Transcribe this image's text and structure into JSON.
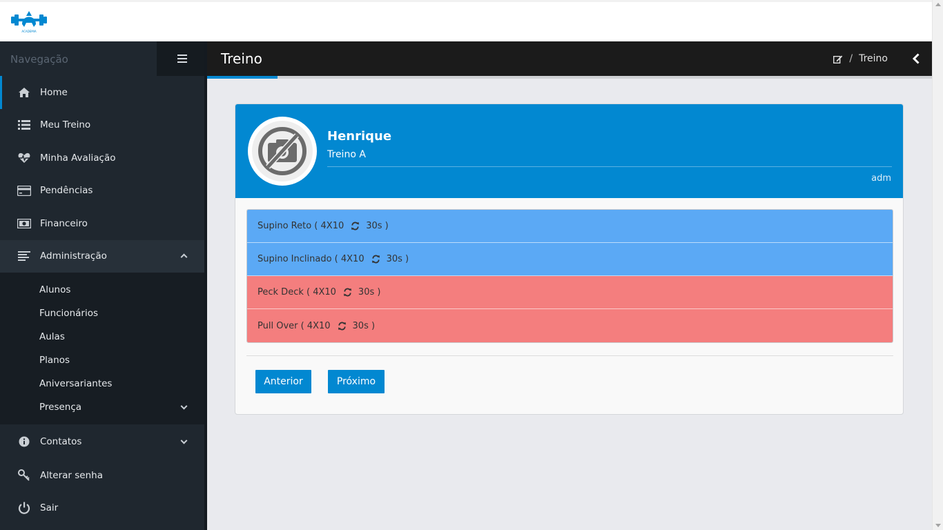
{
  "brand": {
    "logo_icon": "gym-spartan-logo",
    "logo_text": "ACADEMIA",
    "color": "#0288d1"
  },
  "sidebar": {
    "title": "Navegação",
    "items": [
      {
        "label": "Home",
        "icon": "home-icon",
        "active": true
      },
      {
        "label": "Meu Treino",
        "icon": "list-icon"
      },
      {
        "label": "Minha Avaliação",
        "icon": "heartbeat-icon"
      },
      {
        "label": "Pendências",
        "icon": "credit-card-icon"
      },
      {
        "label": "Financeiro",
        "icon": "money-icon"
      },
      {
        "label": "Administração",
        "icon": "align-left-icon",
        "expanded": true,
        "children": [
          "Alunos",
          "Funcionários",
          "Aulas",
          "Planos",
          "Aniversariantes",
          "Presença"
        ]
      },
      {
        "label": "Contatos",
        "icon": "info-icon"
      },
      {
        "label": "Alterar senha",
        "icon": "key-icon"
      },
      {
        "label": "Sair",
        "icon": "power-icon"
      }
    ]
  },
  "header": {
    "title": "Treino",
    "breadcrumb": {
      "sep": "/",
      "current": "Treino"
    }
  },
  "card": {
    "name": "Henrique",
    "subtitle": "Treino A",
    "meta": "adm",
    "exercises": [
      {
        "name": "Supino Reto ( 4X10",
        "rest": "30s )",
        "status": "blue"
      },
      {
        "name": "Supino Inclinado ( 4X10",
        "rest": "30s )",
        "status": "blue"
      },
      {
        "name": "Peck Deck ( 4X10",
        "rest": "30s )",
        "status": "red"
      },
      {
        "name": "Pull Over ( 4X10",
        "rest": "30s )",
        "status": "red"
      }
    ],
    "buttons": {
      "prev": "Anterior",
      "next": "Próximo"
    }
  },
  "colors": {
    "primary": "#0288d1",
    "row_blue": "#5ba9f5",
    "row_red": "#f47e7e",
    "sidebar": "#1f272f"
  }
}
